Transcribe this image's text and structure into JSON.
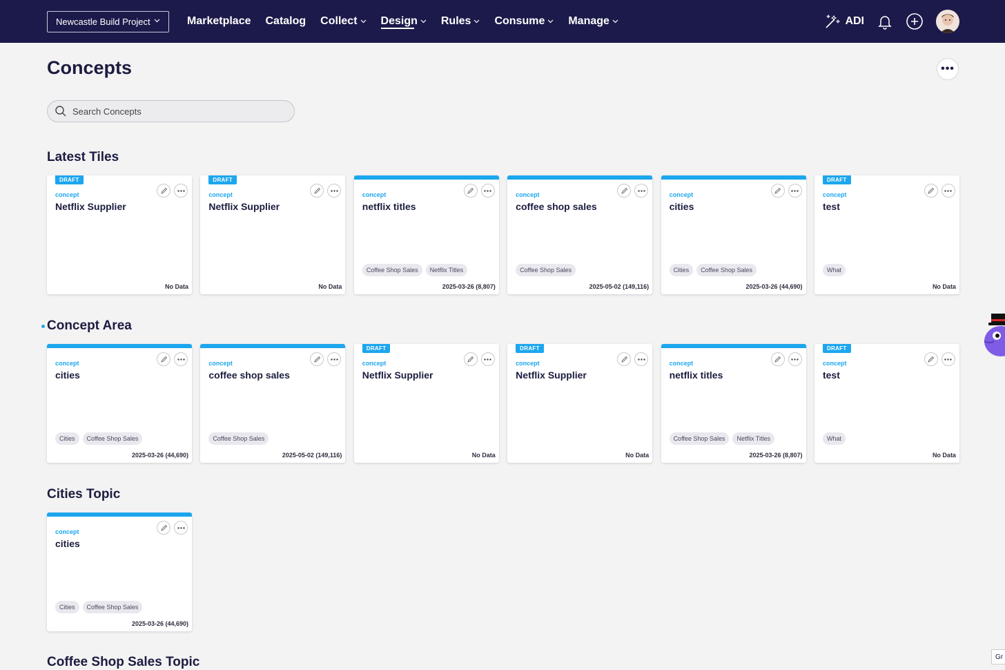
{
  "topbar": {
    "project": "Newcastle Build Project",
    "nav": [
      {
        "label": "Marketplace",
        "has_menu": false
      },
      {
        "label": "Catalog",
        "has_menu": false
      },
      {
        "label": "Collect",
        "has_menu": true
      },
      {
        "label": "Design",
        "has_menu": true,
        "active": true
      },
      {
        "label": "Rules",
        "has_menu": true
      },
      {
        "label": "Consume",
        "has_menu": true
      },
      {
        "label": "Manage",
        "has_menu": true
      }
    ],
    "adi_label": "ADI",
    "icons": [
      "magic-wand-icon",
      "bell-icon",
      "plus-circle-icon",
      "avatar"
    ]
  },
  "page": {
    "title": "Concepts",
    "menu": "•••",
    "search_placeholder": "Search Concepts"
  },
  "colors": {
    "nav_bg": "#1c1a4a",
    "accent": "#1ca6ee",
    "page_bg": "#f3f3f4"
  },
  "sections": [
    {
      "title": "Latest Tiles",
      "marker": false,
      "cards": [
        {
          "draft": true,
          "type": "concept",
          "name": "Netflix Supplier",
          "tags": [],
          "footer": "No Data"
        },
        {
          "draft": true,
          "type": "concept",
          "name": "Netflix Supplier",
          "tags": [],
          "footer": "No Data"
        },
        {
          "draft": false,
          "type": "concept",
          "name": "netflix titles",
          "tags": [
            "Coffee Shop Sales",
            "Netflix Titles"
          ],
          "footer": "2025-03-26 (8,807)"
        },
        {
          "draft": false,
          "type": "concept",
          "name": "coffee shop sales",
          "tags": [
            "Coffee Shop Sales"
          ],
          "footer": "2025-05-02 (149,116)"
        },
        {
          "draft": false,
          "type": "concept",
          "name": "cities",
          "tags": [
            "Cities",
            "Coffee Shop Sales"
          ],
          "footer": "2025-03-26 (44,690)"
        },
        {
          "draft": true,
          "type": "concept",
          "name": "test",
          "tags": [
            "What"
          ],
          "footer": "No Data"
        }
      ]
    },
    {
      "title": "Concept Area",
      "marker": true,
      "cards": [
        {
          "draft": false,
          "type": "concept",
          "name": "cities",
          "tags": [
            "Cities",
            "Coffee Shop Sales"
          ],
          "footer": "2025-03-26 (44,690)"
        },
        {
          "draft": false,
          "type": "concept",
          "name": "coffee shop sales",
          "tags": [
            "Coffee Shop Sales"
          ],
          "footer": "2025-05-02 (149,116)"
        },
        {
          "draft": true,
          "type": "concept",
          "name": "Netflix Supplier",
          "tags": [],
          "footer": "No Data"
        },
        {
          "draft": true,
          "type": "concept",
          "name": "Netflix Supplier",
          "tags": [],
          "footer": "No Data"
        },
        {
          "draft": false,
          "type": "concept",
          "name": "netflix titles",
          "tags": [
            "Coffee Shop Sales",
            "Netflix Titles"
          ],
          "footer": "2025-03-26 (8,807)"
        },
        {
          "draft": true,
          "type": "concept",
          "name": "test",
          "tags": [
            "What"
          ],
          "footer": "No Data"
        }
      ]
    },
    {
      "title": "Cities Topic",
      "marker": false,
      "cards": [
        {
          "draft": false,
          "type": "concept",
          "name": "cities",
          "tags": [
            "Cities",
            "Coffee Shop Sales"
          ],
          "footer": "2025-03-26 (44,690)"
        }
      ]
    },
    {
      "title": "Coffee Shop Sales Topic",
      "marker": false,
      "cards": []
    }
  ],
  "draft_label": "DRAFT",
  "corner_label": "Gr"
}
